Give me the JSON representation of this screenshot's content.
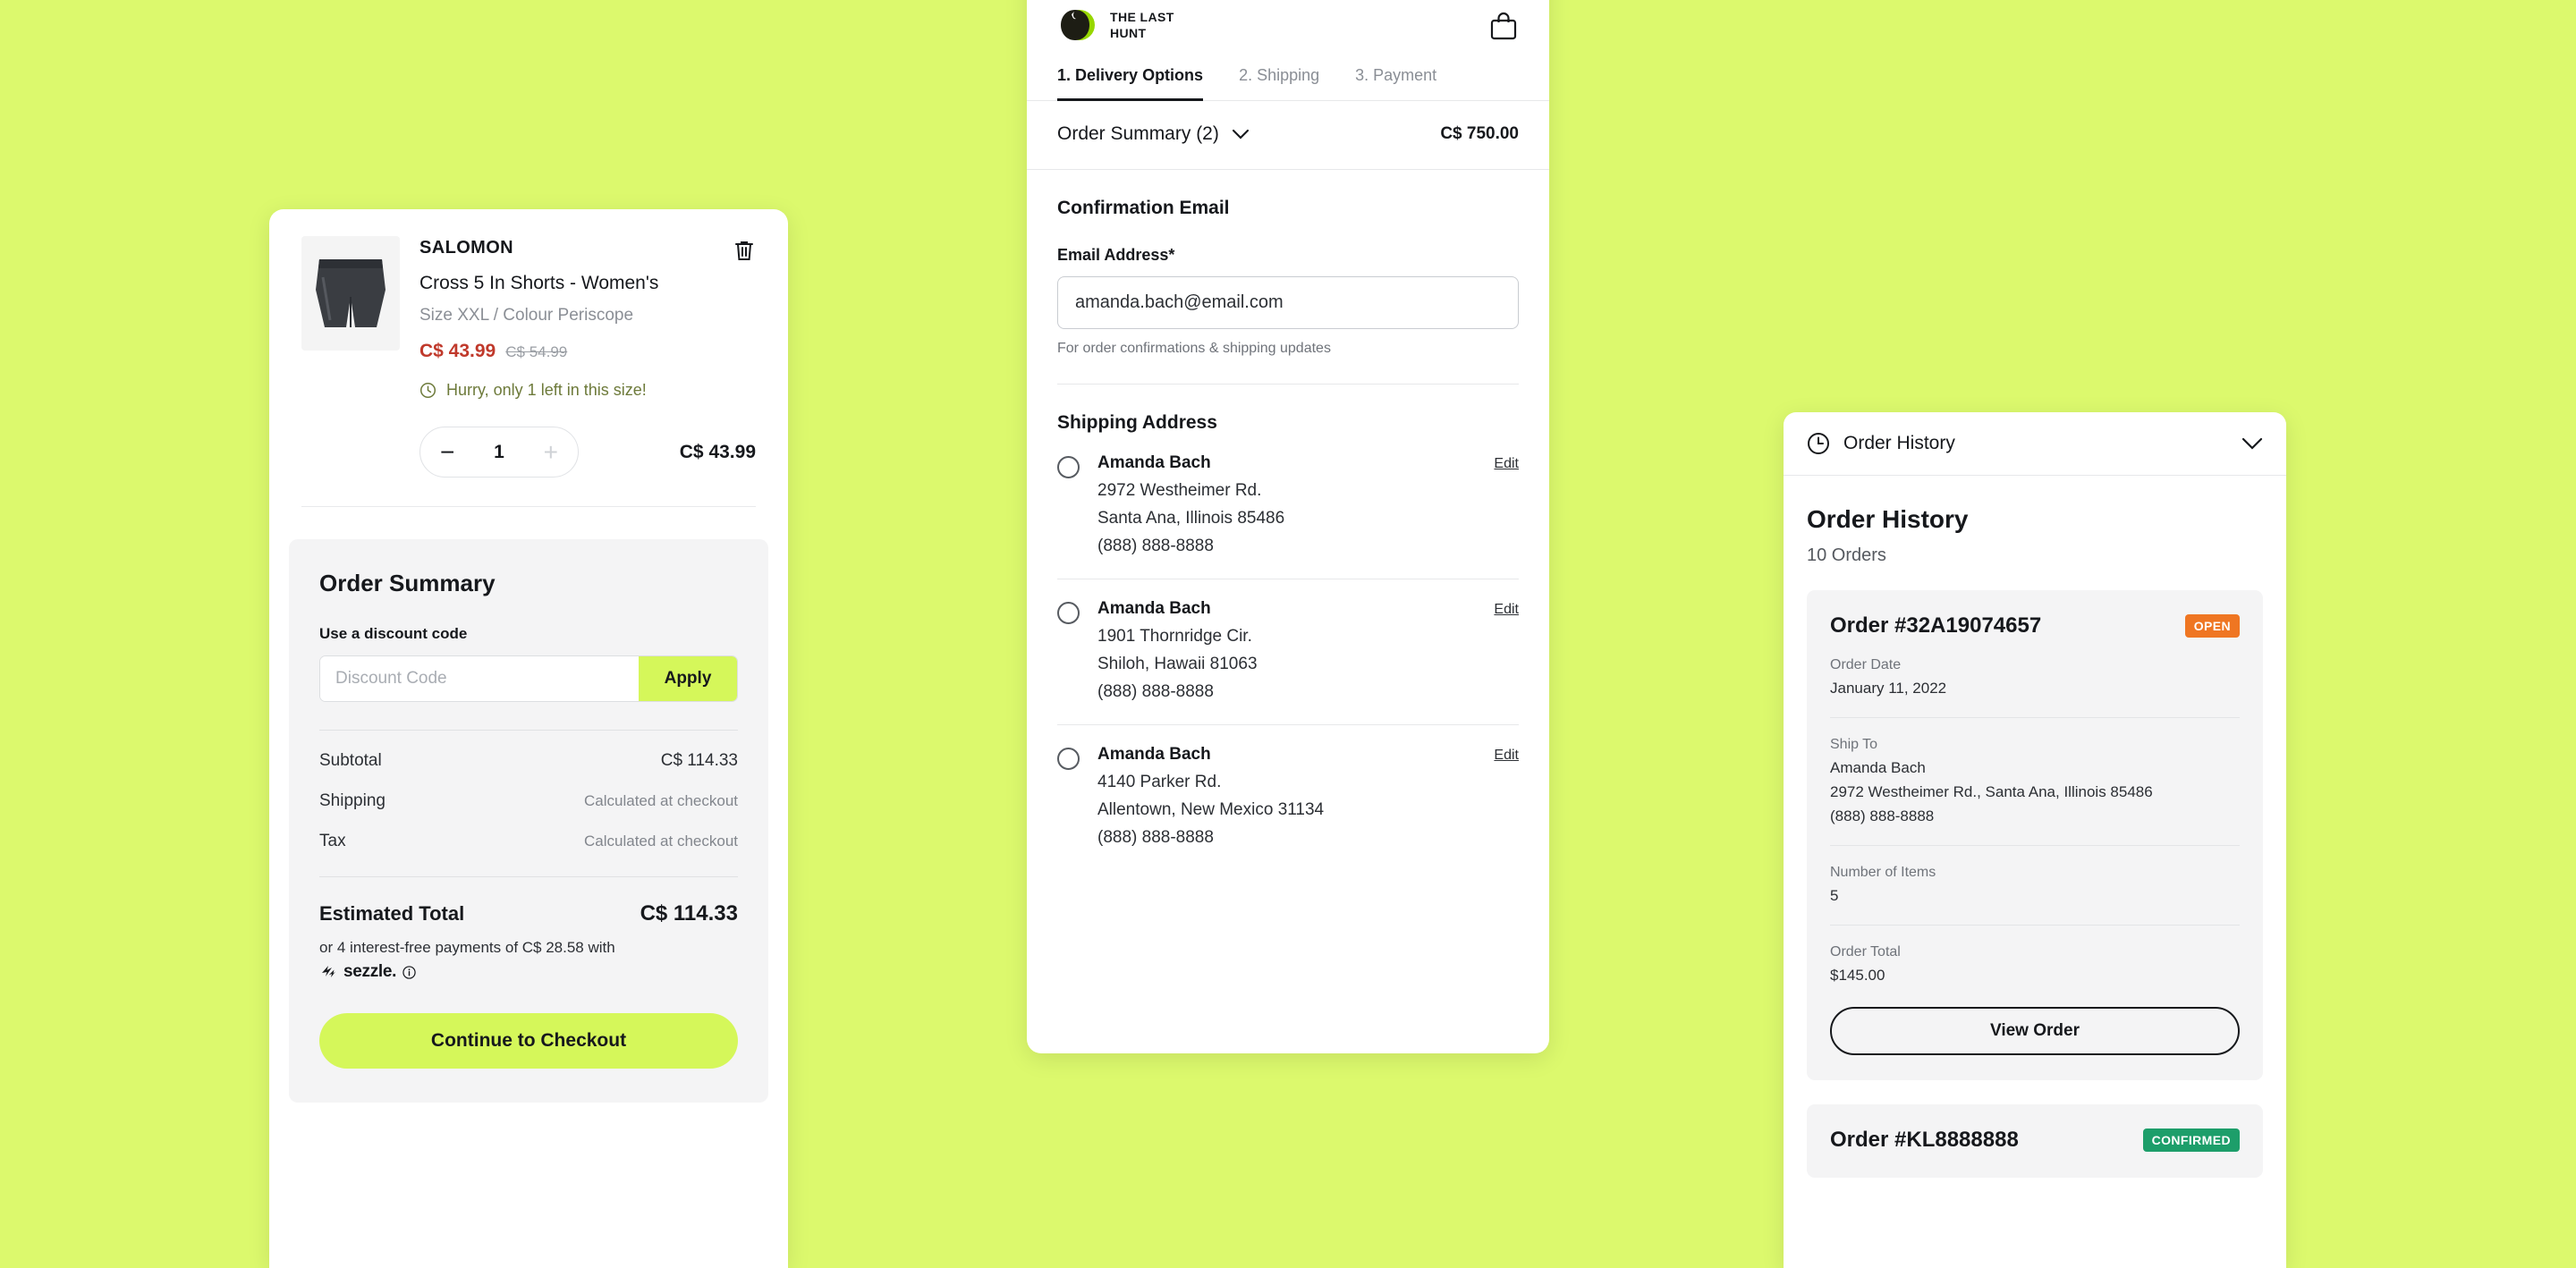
{
  "theme": {
    "background": "#dcf96d",
    "accent": "#d5f75a",
    "sale_price": "#c0392b",
    "badge_open": "#ef7622",
    "badge_confirmed": "#1d9e6a"
  },
  "cart": {
    "item": {
      "brand": "SALOMON",
      "name": "Cross 5 In Shorts - Women's",
      "variant": "Size XXL / Colour Periscope",
      "price_sale": "C$ 43.99",
      "price_was": "C$ 54.99",
      "stock_warning": "Hurry, only 1 left in this size!",
      "quantity": "1",
      "decrement_label": "−",
      "increment_label": "+",
      "line_total": "C$ 43.99",
      "delete_label": "Delete item"
    },
    "summary": {
      "title": "Order Summary",
      "discount_label": "Use a discount code",
      "discount_value": "",
      "discount_placeholder": "Discount Code",
      "apply_label": "Apply",
      "lines": [
        {
          "key": "Subtotal",
          "value": "C$ 114.33",
          "muted": false
        },
        {
          "key": "Shipping",
          "value": "Calculated at checkout",
          "muted": true
        },
        {
          "key": "Tax",
          "value": "Calculated at checkout",
          "muted": true
        }
      ],
      "total_key": "Estimated Total",
      "total_value": "C$ 114.33",
      "sezzle_text": "or 4 interest-free payments of C$ 28.58 with",
      "sezzle_brand": "sezzle.",
      "checkout_label": "Continue to Checkout"
    }
  },
  "checkout": {
    "brand_line1": "THE LAST",
    "brand_line2": "HUNT",
    "tabs": [
      {
        "label": "1. Delivery Options",
        "active": true
      },
      {
        "label": "2. Shipping",
        "active": false
      },
      {
        "label": "3. Payment",
        "active": false
      }
    ],
    "order_summary": {
      "label": "Order Summary (2)",
      "total": "C$ 750.00"
    },
    "email_section": {
      "heading": "Confirmation Email",
      "field_label": "Email Address*",
      "value": "amanda.bach@email.com",
      "placeholder": "Email Address",
      "hint": "For order confirmations & shipping updates"
    },
    "shipping_section": {
      "heading": "Shipping Address",
      "edit_label": "Edit",
      "addresses": [
        {
          "name": "Amanda Bach",
          "street": "2972 Westheimer Rd.",
          "city": "Santa Ana, Illinois 85486",
          "phone": "(888) 888-8888"
        },
        {
          "name": "Amanda Bach",
          "street": "1901 Thornridge Cir.",
          "city": "Shiloh, Hawaii 81063",
          "phone": "(888) 888-8888"
        },
        {
          "name": "Amanda Bach",
          "street": "4140 Parker Rd.",
          "city": "Allentown, New Mexico 31134",
          "phone": "(888) 888-8888"
        }
      ]
    }
  },
  "order_history": {
    "header_title": "Order History",
    "title": "Order History",
    "count": "10 Orders",
    "view_order_label": "View Order",
    "labels": {
      "order_date": "Order Date",
      "ship_to": "Ship To",
      "number_of_items": "Number of Items",
      "order_total": "Order Total"
    },
    "orders": [
      {
        "number": "Order #32A19074657",
        "status": "OPEN",
        "status_kind": "open",
        "order_date": "January 11, 2022",
        "ship_to_name": "Amanda Bach",
        "ship_to_address": "2972 Westheimer Rd., Santa Ana, Illinois 85486",
        "ship_to_phone": "(888) 888-8888",
        "items": "5",
        "total": "$145.00"
      },
      {
        "number": "Order #KL8888888",
        "status": "CONFIRMED",
        "status_kind": "confirmed"
      }
    ]
  }
}
